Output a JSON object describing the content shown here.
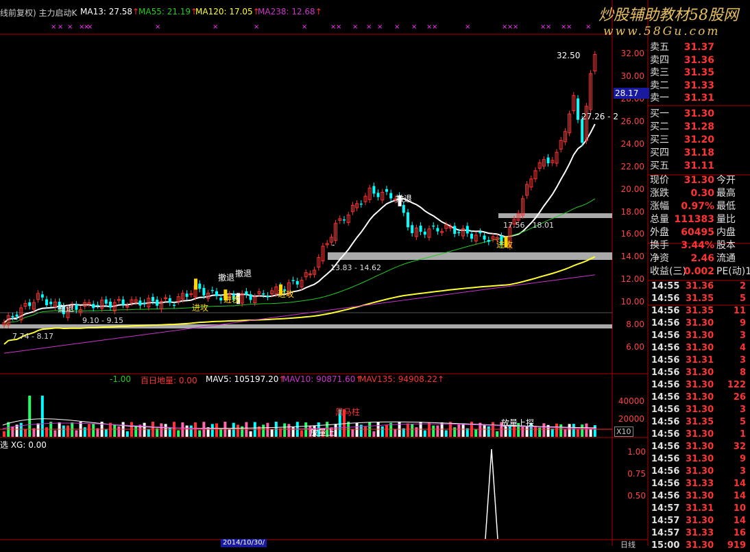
{
  "header": {
    "indicator_title": "线前复权) 主力启动K",
    "ma13": "MA13: 27.58",
    "ma55": "MA55: 21.19",
    "ma120": "MA120: 17.05",
    "ma238": "MA238: 12.68",
    "arrow": "↑",
    "watermark_title": "炒股辅助教材58股网",
    "watermark_url": "www.58Gu.com"
  },
  "colors": {
    "up": "#ff3333",
    "down": "#00ffff",
    "ma13": "#ffffff",
    "ma55": "#22cc22",
    "ma120": "#ffff33",
    "ma238": "#cc33cc",
    "signal": "#ff33ff",
    "gold": "#ffd700"
  },
  "price_axis": [
    "32.00",
    "30.00",
    "28.00",
    "26.00",
    "24.00",
    "22.00",
    "20.00",
    "18.00",
    "16.00",
    "14.00",
    "12.00",
    "10.00",
    "8.00",
    "6.00"
  ],
  "current_price_tag": "28.17",
  "annotations": {
    "high_label": "32.50",
    "ma_label": "27.26 - 2",
    "retreat": "撤退",
    "attack": "进攻",
    "range_1": "7.74 - 8.17",
    "range_2": "9.10 - 9.15",
    "range_3": "13.83 - 14.62",
    "range_4": "17.56 - 18.01",
    "dash": "-"
  },
  "volume_header": {
    "v1": "-1.00",
    "v2": "百日地量: 0.00",
    "mav5": "MAV5: 105197.20",
    "mav10": "MAV10: 90871.60",
    "mav135": "MAV135: 94908.22"
  },
  "volume_axis": [
    "40000",
    "20000"
  ],
  "volume_unit": "X10",
  "volume_annotations": {
    "horse": "黑马柱",
    "vol_up": "放量上探",
    "vol_up2": "放量上探",
    "vol_up3": "放量上"
  },
  "signal_header": "选 XG: 0.00",
  "signal_axis": [
    "1.00",
    "0.75",
    "0.50"
  ],
  "date_axis_label": "2014/10/30/",
  "period_label": "日线",
  "quote_panel": {
    "asks": [
      {
        "label": "卖五",
        "price": "31.37"
      },
      {
        "label": "卖四",
        "price": "31.36"
      },
      {
        "label": "卖三",
        "price": "31.35"
      },
      {
        "label": "卖二",
        "price": "31.33"
      },
      {
        "label": "卖一",
        "price": "31.31"
      }
    ],
    "bids": [
      {
        "label": "买一",
        "price": "31.30"
      },
      {
        "label": "买二",
        "price": "31.28"
      },
      {
        "label": "买三",
        "price": "31.20"
      },
      {
        "label": "买四",
        "price": "31.18"
      },
      {
        "label": "买五",
        "price": "31.11"
      }
    ],
    "stats": [
      {
        "label": "现价",
        "value": "31.30",
        "right": "今开"
      },
      {
        "label": "涨跌",
        "value": "0.30",
        "right": "最高"
      },
      {
        "label": "涨幅",
        "value": "0.97%",
        "right": "最低"
      },
      {
        "label": "总量",
        "value": "111383",
        "right": "量比"
      },
      {
        "label": "外盘",
        "value": "60495",
        "right": "内盘"
      },
      {
        "label": "换手",
        "value": "3.44%",
        "right": "股本"
      },
      {
        "label": "净资",
        "value": "2.46",
        "right": "流通"
      },
      {
        "label": "收益(三)",
        "value": "0.002",
        "right": "PE(动)1"
      }
    ],
    "ticks": [
      {
        "time": "14:55",
        "price": "31.36",
        "qty": "2"
      },
      {
        "time": "14:56",
        "price": "31.35",
        "qty": "5"
      },
      {
        "time": "14:56",
        "price": "31.35",
        "qty": "11"
      },
      {
        "time": "14:56",
        "price": "31.30",
        "qty": "9"
      },
      {
        "time": "14:56",
        "price": "31.30",
        "qty": "3"
      },
      {
        "time": "14:56",
        "price": "31.30",
        "qty": "4"
      },
      {
        "time": "14:56",
        "price": "31.31",
        "qty": "3"
      },
      {
        "time": "14:56",
        "price": "31.30",
        "qty": "8"
      },
      {
        "time": "14:56",
        "price": "31.30",
        "qty": "122"
      },
      {
        "time": "14:56",
        "price": "31.30",
        "qty": "26"
      },
      {
        "time": "14:56",
        "price": "31.30",
        "qty": "3"
      },
      {
        "time": "14:56",
        "price": "31.35",
        "qty": "5"
      },
      {
        "time": "14:56",
        "price": "31.30",
        "qty": "1"
      },
      {
        "time": "14:56",
        "price": "31.30",
        "qty": "32"
      },
      {
        "time": "14:56",
        "price": "31.30",
        "qty": "9"
      },
      {
        "time": "14:56",
        "price": "31.30",
        "qty": "3"
      },
      {
        "time": "14:56",
        "price": "31.33",
        "qty": "14"
      },
      {
        "time": "14:56",
        "price": "31.30",
        "qty": "14"
      },
      {
        "time": "14:57",
        "price": "31.31",
        "qty": "10"
      },
      {
        "time": "14:57",
        "price": "31.30",
        "qty": "14"
      },
      {
        "time": "14:57",
        "price": "31.33",
        "qty": "16"
      },
      {
        "time": "15:00",
        "price": "31.30",
        "qty": "919"
      }
    ]
  }
}
